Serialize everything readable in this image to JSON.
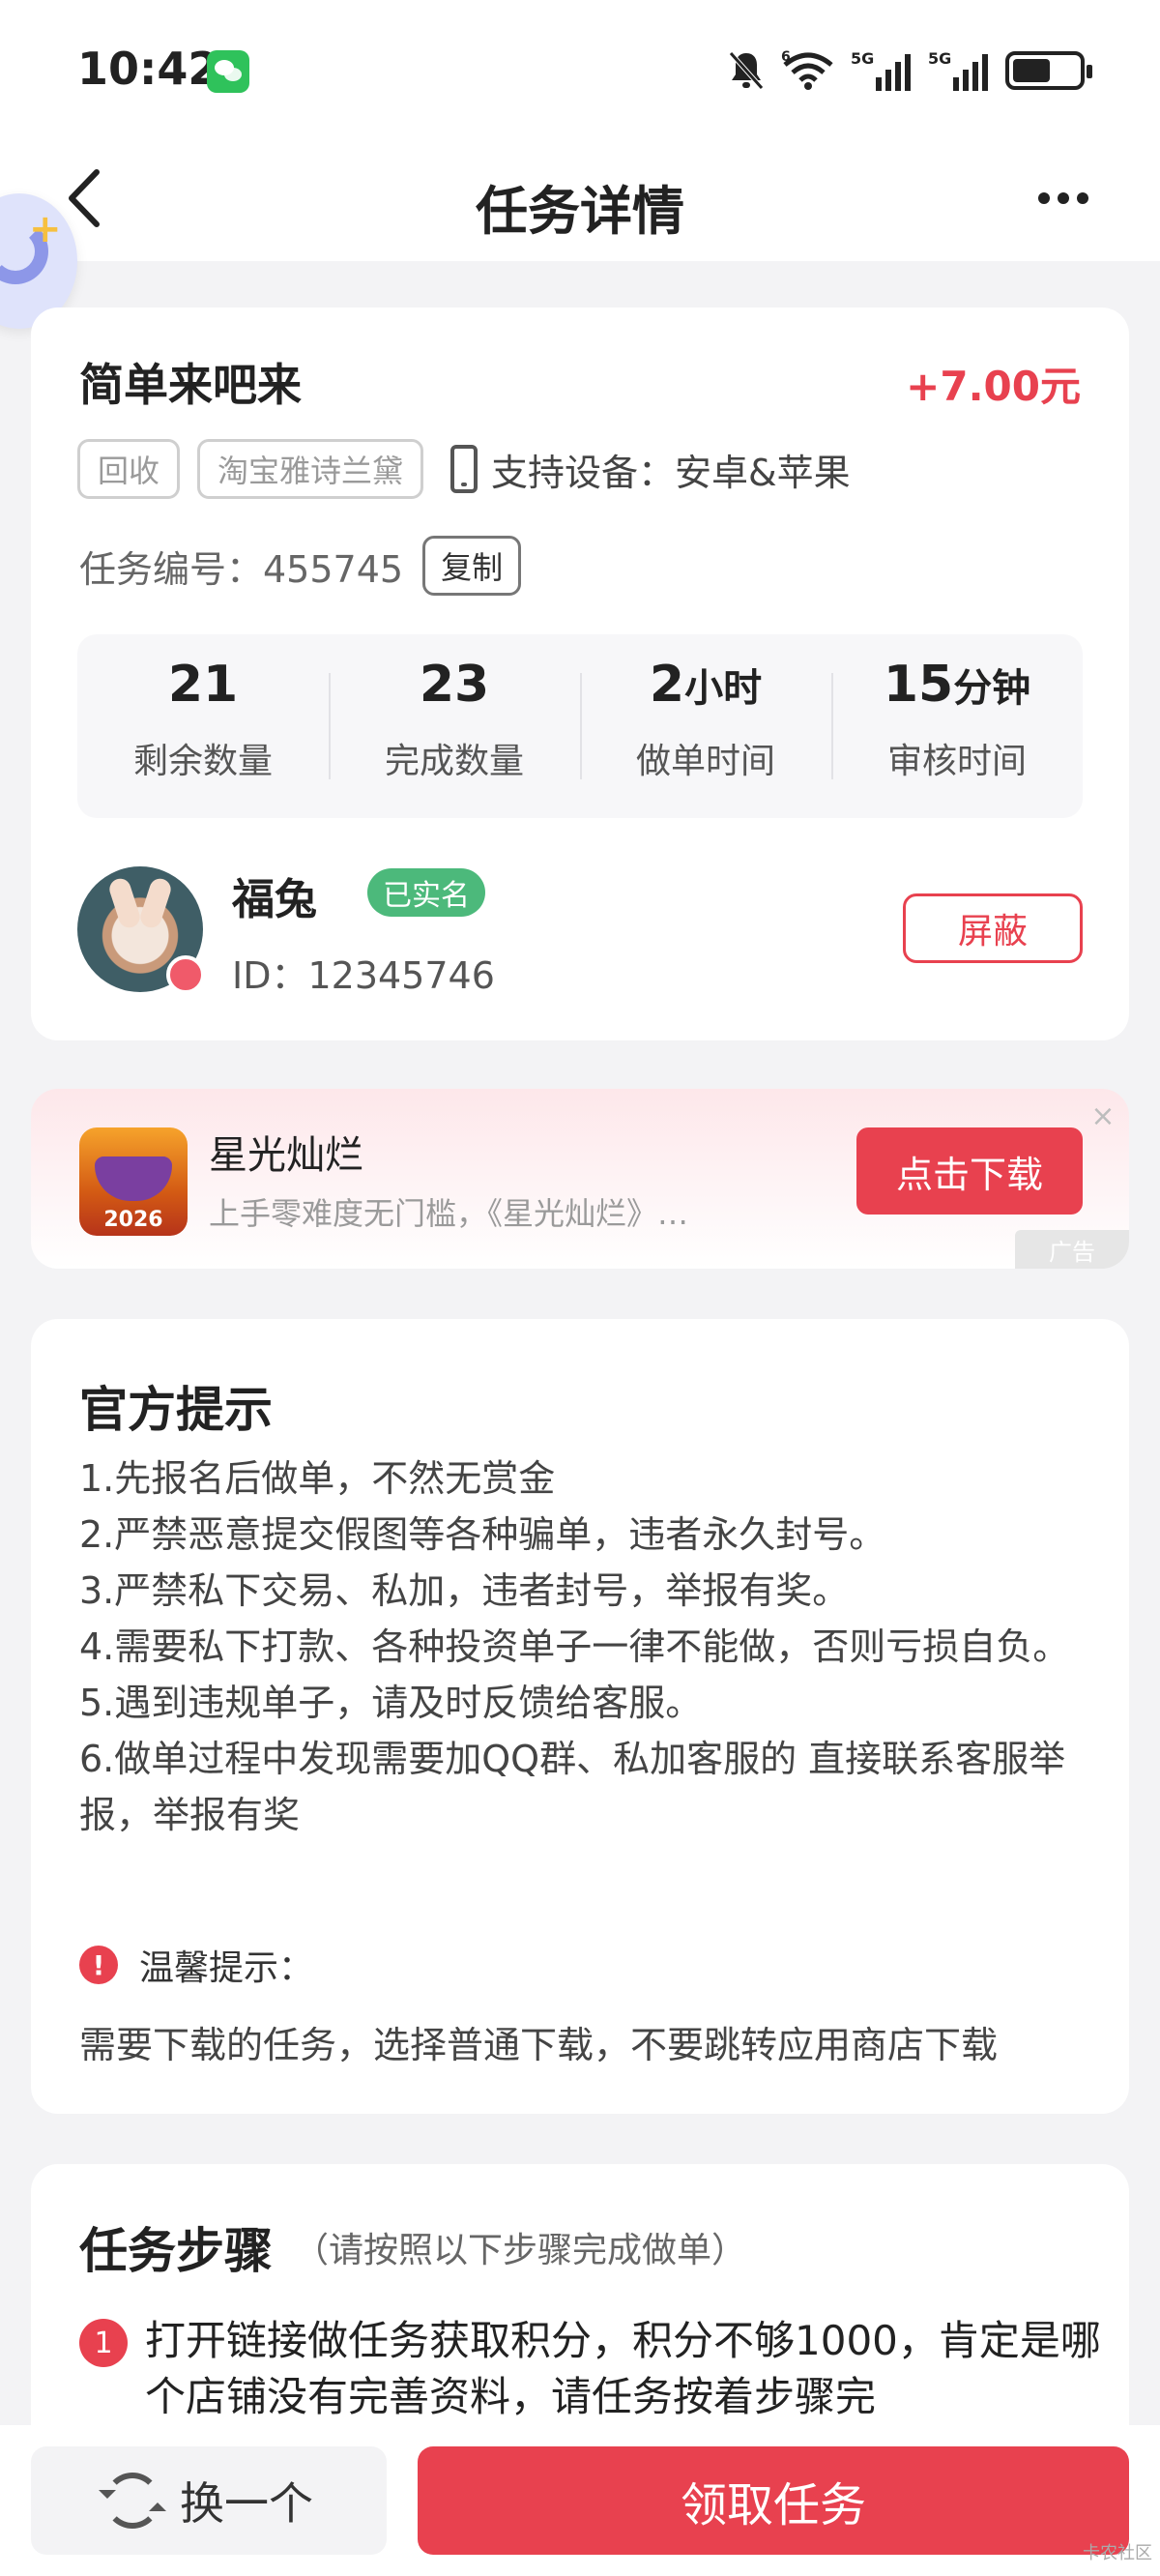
{
  "status_bar": {
    "time": "10:42",
    "network_labels": [
      "6",
      "5G",
      "5G"
    ]
  },
  "nav": {
    "title": "任务详情"
  },
  "task": {
    "title": "简单来吧来",
    "reward": "+7.00元",
    "tags": [
      "回收",
      "淘宝雅诗兰黛"
    ],
    "device_text": "支持设备：安卓&苹果",
    "task_no_label": "任务编号：455745",
    "copy_label": "复制",
    "stats": [
      {
        "value": "21",
        "unit": "",
        "label": "剩余数量"
      },
      {
        "value": "23",
        "unit": "",
        "label": "完成数量"
      },
      {
        "value": "2",
        "unit": "小时",
        "label": "做单时间"
      },
      {
        "value": "15",
        "unit": "分钟",
        "label": "审核时间"
      }
    ]
  },
  "owner": {
    "name": "福兔",
    "verified_label": "已实名",
    "id_text": "ID：12345746",
    "block_label": "屏蔽"
  },
  "ad": {
    "title": "星光灿烂",
    "description": "上手零难度无门槛，《星光灿烂》全民都...",
    "icon_year": "2026",
    "button_label": "点击下载",
    "close_symbol": "×",
    "tag_label": "广告"
  },
  "tips": {
    "title": "官方提示",
    "items": [
      "1.先报名后做单，不然无赏金",
      "2.严禁恶意提交假图等各种骗单，违者永久封号。",
      "3.严禁私下交易、私加，违者封号，举报有奖。",
      "4.需要私下打款、各种投资单子一律不能做，否则亏损自负。",
      "5.遇到违规单子，请及时反馈给客服。",
      "6.做单过程中发现需要加QQ群、私加客服的 直接联系客服举报，举报有奖"
    ],
    "warm_label": "温馨提示：",
    "warm_text": "需要下载的任务，选择普通下载，不要跳转应用商店下载"
  },
  "steps": {
    "title": "任务步骤",
    "hint": "（请按照以下步骤完成做单）",
    "items": [
      {
        "num": "1",
        "text": "打开链接做任务获取积分，积分不够1000，肯定是哪个店铺没有完善资料，请任务按着步骤完"
      }
    ]
  },
  "bottom": {
    "swap_label": "换一个",
    "claim_label": "领取任务",
    "watermark": "卡农社区"
  },
  "colors": {
    "accent": "#e8414f",
    "verified": "#4cb97b",
    "background": "#f3f3f5"
  }
}
